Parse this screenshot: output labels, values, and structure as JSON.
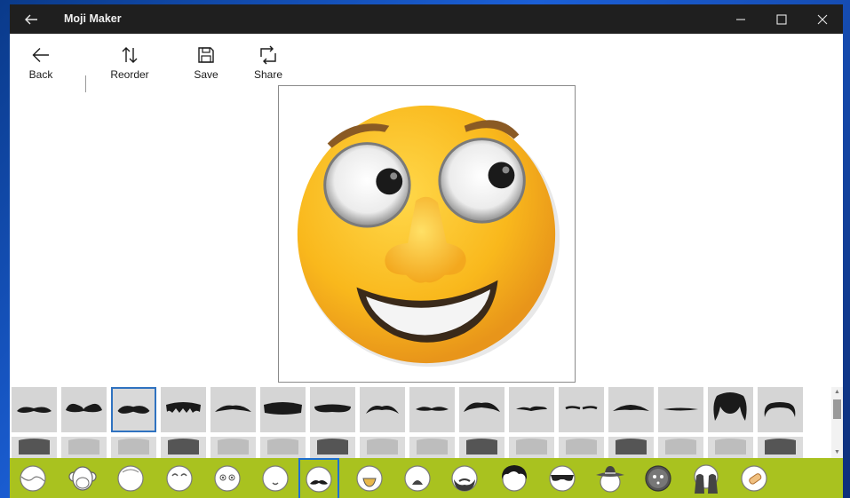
{
  "window": {
    "title": "Moji Maker"
  },
  "toolbar": {
    "back_label": "Back",
    "reorder_label": "Reorder",
    "save_label": "Save",
    "share_label": "Share"
  },
  "stickers": {
    "category": "mustaches",
    "selected_index": 2,
    "row1": [
      "mustache-1",
      "mustache-2",
      "mustache-3",
      "mustache-4",
      "mustache-5",
      "mustache-6",
      "mustache-7",
      "mustache-8",
      "mustache-9",
      "mustache-10",
      "mustache-11",
      "mustache-12",
      "mustache-13",
      "mustache-14",
      "mustache-15",
      "mustache-16"
    ]
  },
  "categories": {
    "selected": "mustaches",
    "items": [
      "face-shape",
      "monkey",
      "face-outline",
      "eyes",
      "round-eyes",
      "mouth-smile",
      "mustaches",
      "open-mouth",
      "frown",
      "beard",
      "hair",
      "sunglasses",
      "sombrero",
      "mask",
      "hands-over-eyes",
      "bandage"
    ]
  },
  "colors": {
    "accent": "#a9c21f",
    "selection": "#2f72c0",
    "titlebar": "#1f1f1f"
  }
}
